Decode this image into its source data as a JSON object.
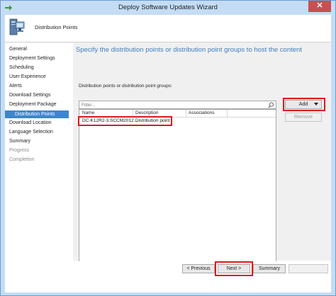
{
  "window": {
    "title": "Deploy Software Updates Wizard",
    "close_glyph": "✕",
    "app_icon": "green-arrow-icon"
  },
  "banner": {
    "title": "Distribution Points",
    "icon": "computer-icon"
  },
  "nav": {
    "items": [
      {
        "label": "General",
        "state": "normal"
      },
      {
        "label": "Deployment Settings",
        "state": "normal"
      },
      {
        "label": "Scheduling",
        "state": "normal"
      },
      {
        "label": "User Experience",
        "state": "normal"
      },
      {
        "label": "Alerts",
        "state": "normal"
      },
      {
        "label": "Download Settings",
        "state": "normal"
      },
      {
        "label": "Deployment Package",
        "state": "normal"
      },
      {
        "label": "Distribution Points",
        "state": "active"
      },
      {
        "label": "Download Location",
        "state": "normal"
      },
      {
        "label": "Language Selection",
        "state": "normal"
      },
      {
        "label": "Summary",
        "state": "normal"
      },
      {
        "label": "Progress",
        "state": "disabled"
      },
      {
        "label": "Completion",
        "state": "disabled"
      }
    ]
  },
  "main": {
    "heading": "Specify the distribution points or distribution point groups to host the content",
    "list_label": "Distribution points or distribution point groups:",
    "filter_placeholder": "Filter...",
    "columns": [
      "Name",
      "Description",
      "Associations"
    ],
    "rows": [
      {
        "name": "DC-K12R2-3.SCCM2012...",
        "description": "Distribution point",
        "associations": ""
      }
    ],
    "add_button": "Add",
    "remove_button": "Remove"
  },
  "footer": {
    "previous_button": "< Previous",
    "next_button": "Next >",
    "summary_button": "Summary"
  },
  "colors": {
    "accent": "#3f85cd",
    "highlight": "#e0161b",
    "heading": "#3f7fc0"
  }
}
